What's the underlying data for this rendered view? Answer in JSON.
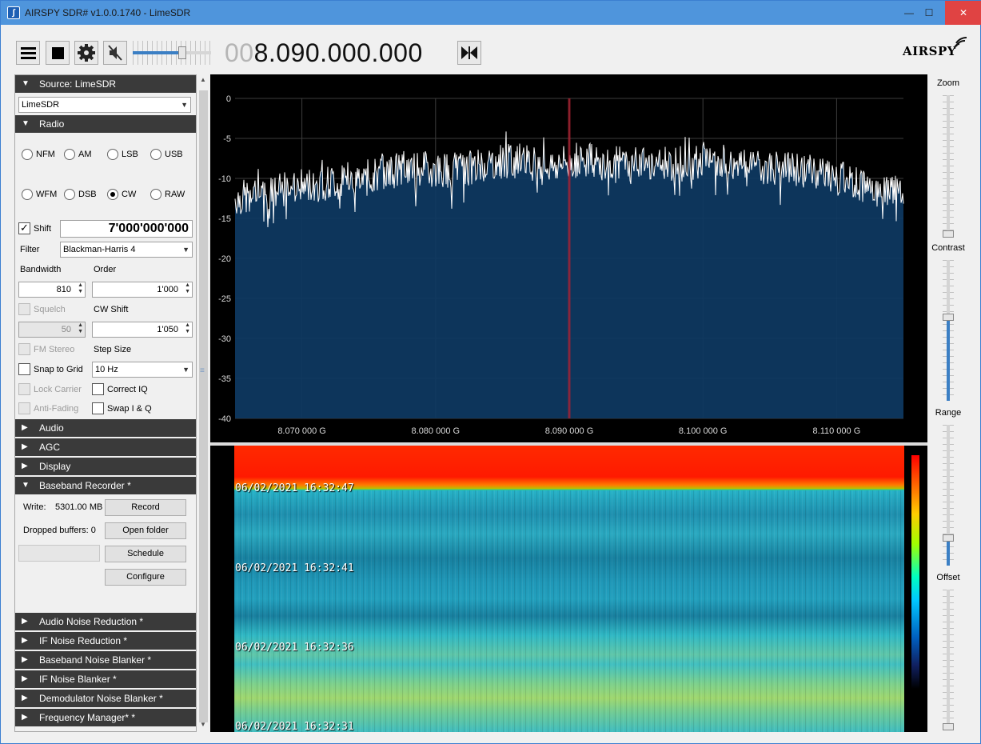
{
  "window": {
    "title": "AIRSPY SDR# v1.0.0.1740 - LimeSDR",
    "min": "—",
    "max": "☐",
    "close": "✕"
  },
  "toolbar": {
    "frequency_dim": "00",
    "frequency_main": "8.090.000.000",
    "volume_level": 0.63,
    "logo": "AIRSPY"
  },
  "source": {
    "header": "Source: LimeSDR",
    "device": "LimeSDR"
  },
  "radio": {
    "header": "Radio",
    "modes_row1": [
      "NFM",
      "AM",
      "LSB",
      "USB"
    ],
    "modes_row2": [
      "WFM",
      "DSB",
      "CW",
      "RAW"
    ],
    "selected_mode": "CW",
    "shift_label": "Shift",
    "shift_value": "7'000'000'000",
    "filter_label": "Filter",
    "filter_value": "Blackman-Harris 4",
    "bandwidth_label": "Bandwidth",
    "bandwidth_value": "810",
    "order_label": "Order",
    "order_value": "1'000",
    "squelch_label": "Squelch",
    "squelch_value": "50",
    "cw_shift_label": "CW Shift",
    "cw_shift_value": "1'050",
    "fm_stereo_label": "FM Stereo",
    "step_size_label": "Step Size",
    "snap_label": "Snap to Grid",
    "step_size_value": "10 Hz",
    "lock_carrier_label": "Lock Carrier",
    "correct_iq_label": "Correct IQ",
    "anti_fading_label": "Anti-Fading",
    "swap_iq_label": "Swap I & Q"
  },
  "sections": {
    "audio": "Audio",
    "agc": "AGC",
    "display": "Display",
    "baseband_recorder": "Baseband Recorder *",
    "audio_nr": "Audio Noise Reduction *",
    "if_nr": "IF Noise Reduction *",
    "baseband_nb": "Baseband Noise Blanker *",
    "if_nb": "IF Noise Blanker *",
    "demod_nb": "Demodulator Noise Blanker *",
    "freq_manager": "Frequency Manager* *"
  },
  "recorder": {
    "write_label": "Write:",
    "write_value": "5301.00 MB",
    "dropped_label": "Dropped buffers: 0",
    "record": "Record",
    "open_folder": "Open folder",
    "schedule": "Schedule",
    "configure": "Configure"
  },
  "right_panel": {
    "zoom": "Zoom",
    "contrast": "Contrast",
    "range": "Range",
    "offset": "Offset",
    "zoom_level": 0.0,
    "contrast_level": 0.6,
    "range_level": 0.18,
    "offset_level": 0.0
  },
  "chart_data": {
    "type": "line",
    "title": "",
    "xlabel": "",
    "ylabel": "",
    "ylim": [
      -40,
      0
    ],
    "yticks": [
      "0",
      "-5",
      "-10",
      "-15",
      "-20",
      "-25",
      "-30",
      "-35",
      "-40"
    ],
    "xticks": [
      "8.070 000 G",
      "8.080 000 G",
      "8.090 000 G",
      "8.100 000 G",
      "8.110 000 G"
    ],
    "xlim": [
      8.065,
      8.115
    ],
    "center_frequency": 8.09,
    "noise_floor_mean": -9.5,
    "series": [
      {
        "values": [
          -12.5,
          -12.0,
          -11.0,
          -10.5,
          -10.0,
          -9.0,
          -8.8,
          -9.0,
          -8.0,
          -7.8,
          -8.5,
          -7.5,
          -8.8,
          -8.0,
          -8.2,
          -7.4,
          -8.5,
          -8.8,
          -9.0,
          -10.0,
          -11.0,
          -12.0
        ]
      }
    ],
    "fill": true,
    "colors": {
      "fill": "#0e3a63",
      "line": "#ffffff",
      "center_marker": "#b02030"
    }
  },
  "waterfall": {
    "timestamps": [
      "06/02/2021 16:32:47",
      "06/02/2021 16:32:41",
      "06/02/2021 16:32:36",
      "06/02/2021 16:32:31"
    ]
  }
}
